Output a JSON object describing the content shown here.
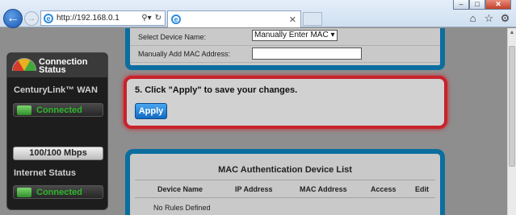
{
  "browser": {
    "url": "http://192.168.0.1",
    "tab_title": "",
    "window_buttons": [
      "–",
      "□",
      "✕"
    ],
    "icons": [
      "home-icon",
      "favorites-star-icon",
      "settings-gear-icon"
    ]
  },
  "status_panel": {
    "title": "Connection Status",
    "wan_label": "CenturyLink™ WAN",
    "wan_status": "Connected",
    "speed": "100/100 Mbps",
    "internet_label": "Internet Status",
    "internet_status": "Connected",
    "status_color": "#2fb52b"
  },
  "form": {
    "select_label": "Select Device Name:",
    "select_value": "Manually Enter MAC",
    "mac_label": "Manually Add MAC Address:",
    "mac_value": ""
  },
  "apply_step": {
    "instruction": "5. Click \"Apply\" to save your changes.",
    "button_label": "Apply",
    "highlight_color": "#c8232b"
  },
  "mac_list": {
    "title": "MAC Authentication Device List",
    "columns": [
      "Device Name",
      "IP Address",
      "MAC Address",
      "Access",
      "Edit"
    ],
    "empty_text": "No Rules Defined"
  },
  "colors": {
    "panel_border": "#0b6e9f",
    "button_blue": "#126bc3"
  }
}
